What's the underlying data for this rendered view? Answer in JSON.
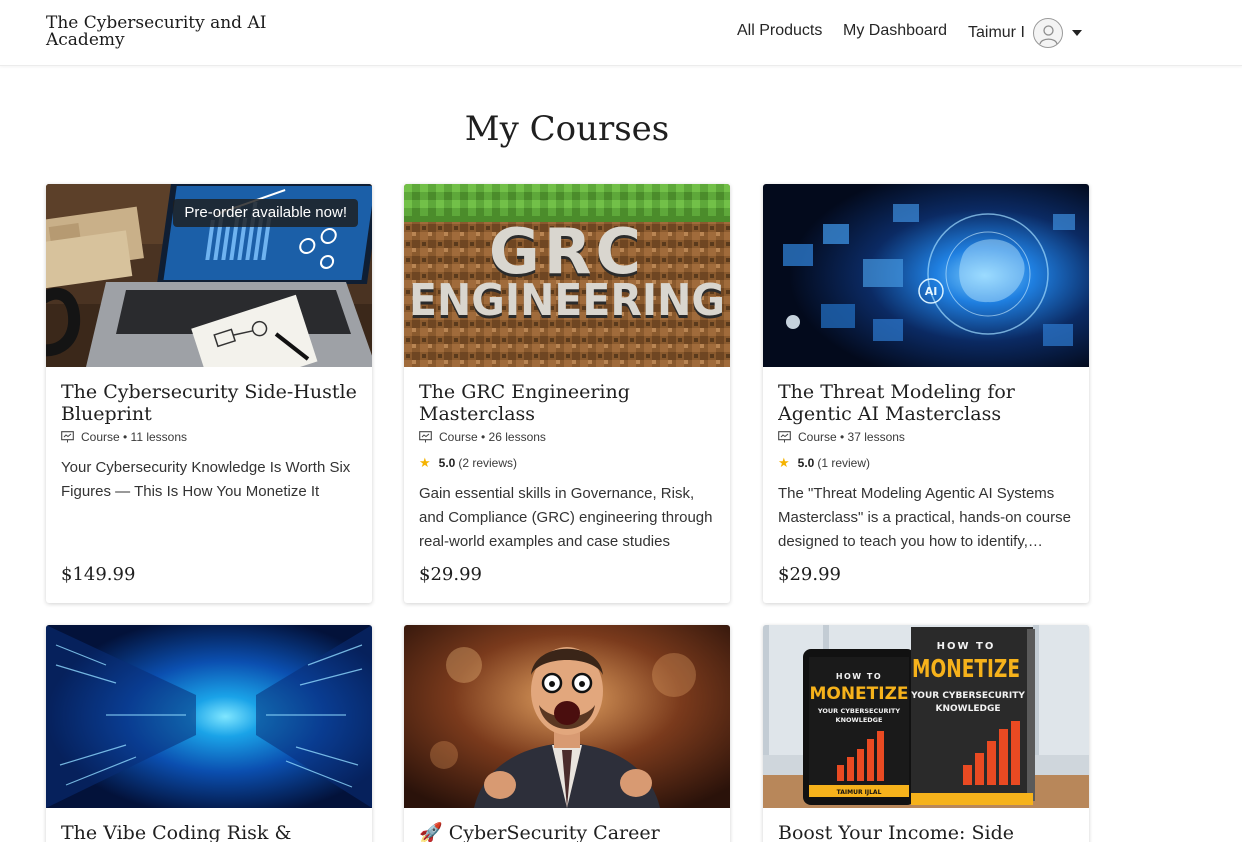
{
  "header": {
    "brand": "The Cybersecurity and AI Academy",
    "nav": {
      "products": "All Products",
      "dashboard": "My Dashboard"
    },
    "user": {
      "name": "Taimur I",
      "avatar_icon": "user-avatar-icon",
      "menu_icon": "caret-down-icon"
    }
  },
  "page": {
    "title": "My Courses"
  },
  "courses": [
    {
      "title": "The Cybersecurity Side-Hustle Blueprint",
      "badge": "Pre-order available now!",
      "meta": "Course • 11 lessons",
      "description": "Your Cybersecurity Knowledge Is Worth Six Figures — This Is How You Monetize It",
      "price": "$149.99"
    },
    {
      "title": "The GRC Engineering Masterclass",
      "image_text": {
        "line1": "GRC",
        "line2": "ENGINEERING"
      },
      "meta": "Course • 26 lessons",
      "rating": {
        "score": "5.0",
        "reviews": "(2 reviews)"
      },
      "description": "Gain essential skills in Governance, Risk, and Compliance (GRC) engineering through real-world examples and case studies",
      "price": "$29.99"
    },
    {
      "title": "The Threat Modeling for Agentic AI Masterclass",
      "image_text": {
        "chip": "AI"
      },
      "meta": "Course • 37 lessons",
      "rating": {
        "score": "5.0",
        "reviews": "(1 review)"
      },
      "description": "The \"Threat Modeling Agentic AI Systems Masterclass\" is a practical, hands-on course designed to teach you how to identify, assess, and mitigate threats in agentic AI systems.",
      "price": "$29.99"
    },
    {
      "title": "The Vibe Coding Risk & Security Masterclass"
    },
    {
      "title": "🚀 CyberSecurity Career Accelerator"
    },
    {
      "title": "Boost Your Income: Side Hustles for Cybersecurity Professionals",
      "image_text": {
        "how_to": "HOW TO",
        "monetize": "MONETIZE",
        "subtitle1": "YOUR CYBERSECURITY",
        "subtitle2": "KNOWLEDGE",
        "author": "TAIMUR IJLAL"
      }
    }
  ],
  "colors": {
    "star": "#f5b301",
    "badge_bg": "#1e1e1e",
    "grass": "#5ea83a",
    "dirt": "#8a5a2e",
    "tech_blue": "#0a4fb0"
  }
}
